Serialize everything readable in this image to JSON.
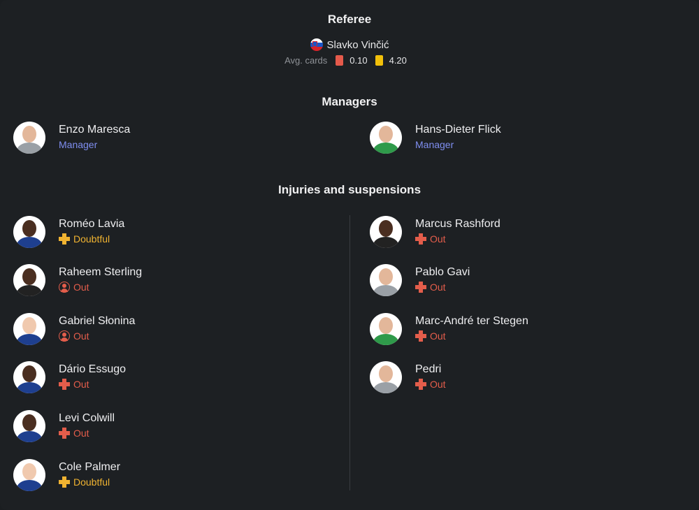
{
  "referee": {
    "heading": "Referee",
    "name": "Slavko Vinčić",
    "avg_label": "Avg. cards",
    "red_avg": "0.10",
    "yellow_avg": "4.20"
  },
  "managers": {
    "heading": "Managers",
    "home": {
      "name": "Enzo Maresca",
      "role": "Manager"
    },
    "away": {
      "name": "Hans-Dieter Flick",
      "role": "Manager"
    }
  },
  "injuries": {
    "heading": "Injuries and suspensions",
    "home": [
      {
        "name": "Roméo Lavia",
        "status": "Doubtful",
        "icon": "injury-icon"
      },
      {
        "name": "Raheem Sterling",
        "status": "Out",
        "icon": "suspension-icon"
      },
      {
        "name": "Gabriel Słonina",
        "status": "Out",
        "icon": "suspension-icon"
      },
      {
        "name": "Dário Essugo",
        "status": "Out",
        "icon": "injury-icon"
      },
      {
        "name": "Levi Colwill",
        "status": "Out",
        "icon": "injury-icon"
      },
      {
        "name": "Cole Palmer",
        "status": "Doubtful",
        "icon": "injury-icon"
      }
    ],
    "away": [
      {
        "name": "Marcus Rashford",
        "status": "Out",
        "icon": "injury-icon"
      },
      {
        "name": "Pablo Gavi",
        "status": "Out",
        "icon": "injury-icon"
      },
      {
        "name": "Marc-André ter Stegen",
        "status": "Out",
        "icon": "injury-icon"
      },
      {
        "name": "Pedri",
        "status": "Out",
        "icon": "injury-icon"
      }
    ]
  },
  "colors": {
    "out": "#e35d4b",
    "doubtful": "#f0b331",
    "manager_role": "#7f8ef0",
    "red_card": "#e55a4b",
    "yellow_card": "#f2c00a"
  }
}
